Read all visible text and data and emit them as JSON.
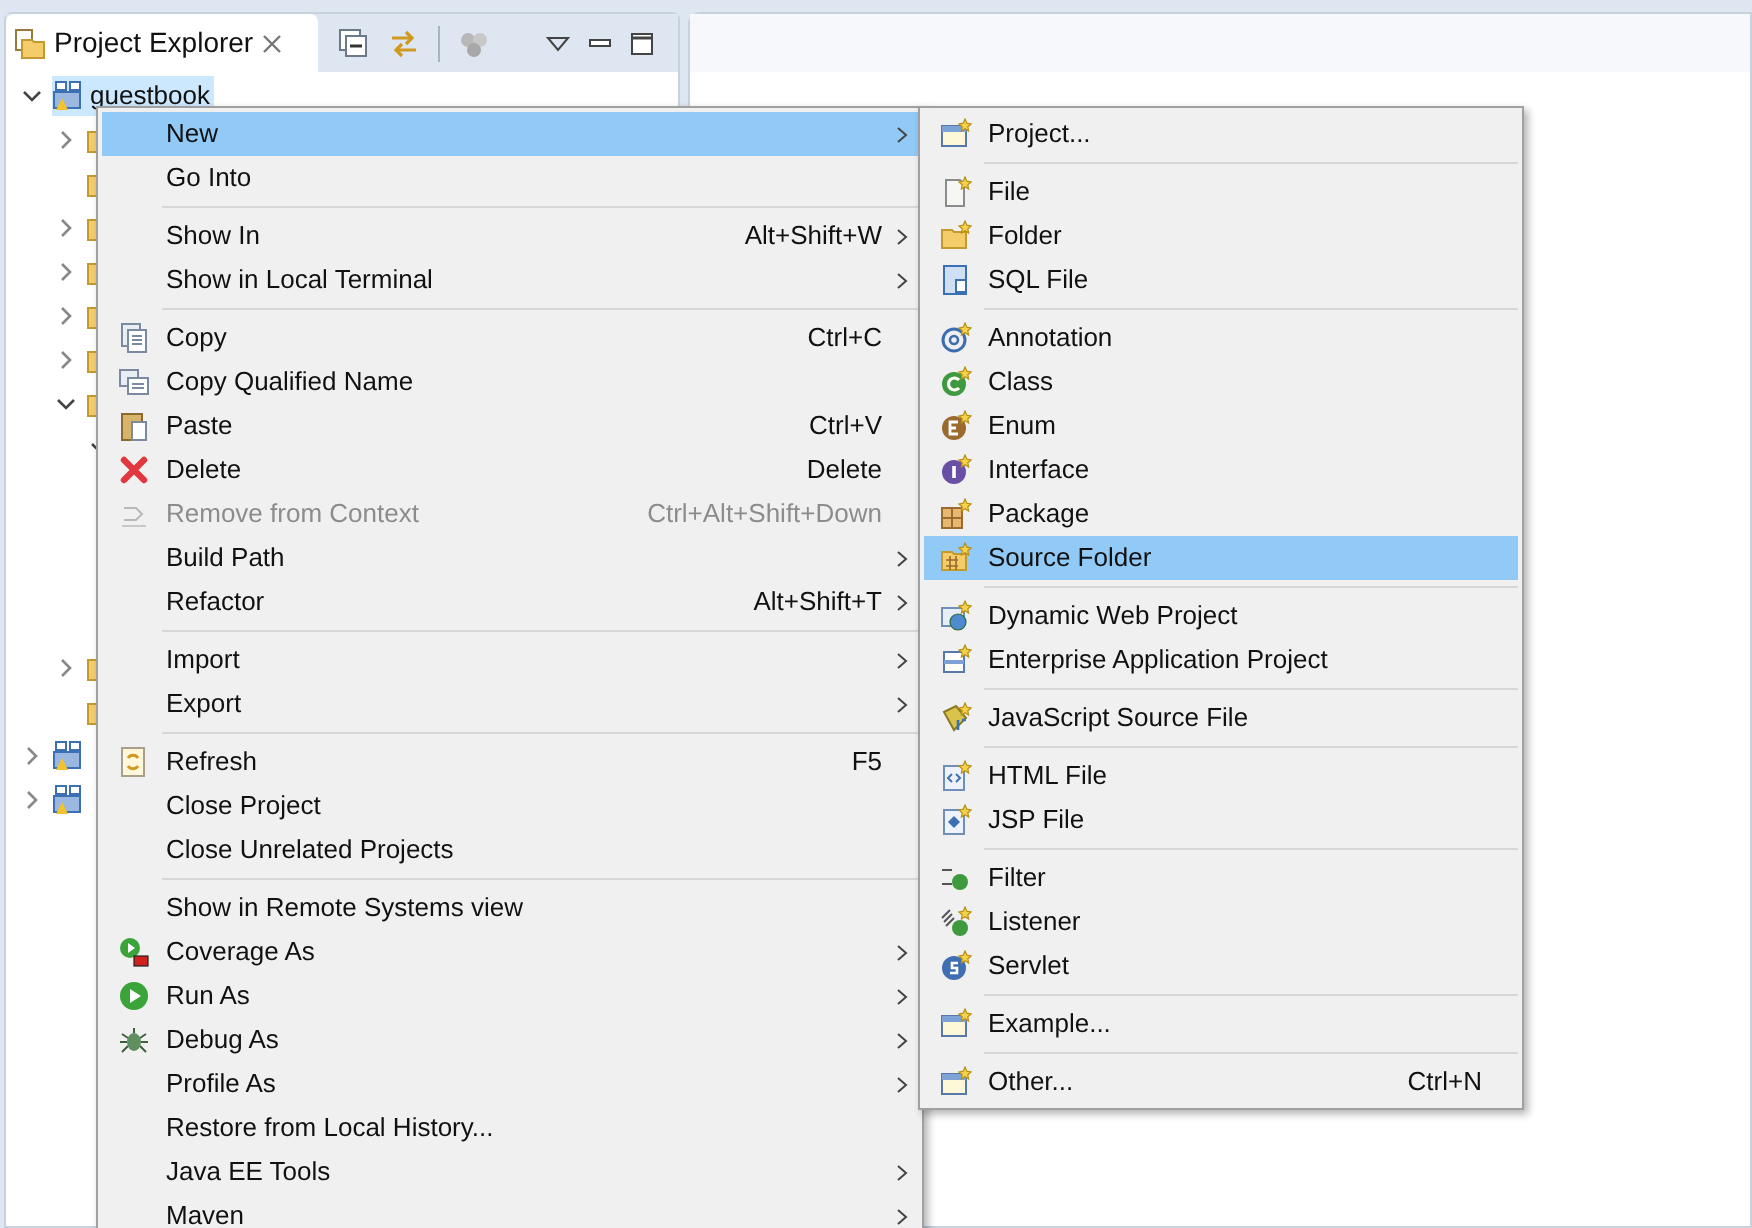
{
  "panel": {
    "title": "Project Explorer"
  },
  "tree": [
    {
      "label": "guestbook",
      "kind": "node",
      "expanded": true,
      "selected": true,
      "children": [
        {
          "kind": "node",
          "expanded": false
        },
        {
          "kind": "leaf"
        },
        {
          "kind": "node",
          "expanded": false
        },
        {
          "kind": "node",
          "expanded": false
        },
        {
          "kind": "node",
          "expanded": false
        },
        {
          "kind": "node",
          "expanded": false
        },
        {
          "kind": "node",
          "expanded": true,
          "children": [
            {
              "kind": "node",
              "expanded": true
            }
          ]
        },
        {
          "kind": "node",
          "expanded": false
        },
        {
          "kind": "leaf"
        }
      ]
    },
    {
      "kind": "node",
      "expanded": false
    },
    {
      "kind": "node",
      "expanded": false
    }
  ],
  "context_menu": [
    {
      "kind": "item",
      "label": "New",
      "selected": true,
      "disabled": false,
      "submenu": true
    },
    {
      "kind": "item",
      "label": "Go Into",
      "selected": false,
      "disabled": false,
      "submenu": false
    },
    {
      "kind": "separator"
    },
    {
      "kind": "item",
      "label": "Show In",
      "shortcut": "Alt+Shift+W",
      "selected": false,
      "disabled": false,
      "submenu": true
    },
    {
      "kind": "item",
      "label": "Show in Local Terminal",
      "selected": false,
      "disabled": false,
      "submenu": true
    },
    {
      "kind": "separator"
    },
    {
      "kind": "item",
      "label": "Copy",
      "shortcut": "Ctrl+C",
      "selected": false,
      "disabled": false,
      "submenu": false
    },
    {
      "kind": "item",
      "label": "Copy Qualified Name",
      "selected": false,
      "disabled": false,
      "submenu": false
    },
    {
      "kind": "item",
      "label": "Paste",
      "shortcut": "Ctrl+V",
      "selected": false,
      "disabled": false,
      "submenu": false
    },
    {
      "kind": "item",
      "label": "Delete",
      "shortcut": "Delete",
      "selected": false,
      "disabled": false,
      "submenu": false
    },
    {
      "kind": "item",
      "label": "Remove from Context",
      "shortcut": "Ctrl+Alt+Shift+Down",
      "selected": false,
      "disabled": true,
      "submenu": false
    },
    {
      "kind": "item",
      "label": "Build Path",
      "selected": false,
      "disabled": false,
      "submenu": true
    },
    {
      "kind": "item",
      "label": "Refactor",
      "shortcut": "Alt+Shift+T",
      "selected": false,
      "disabled": false,
      "submenu": true
    },
    {
      "kind": "separator"
    },
    {
      "kind": "item",
      "label": "Import",
      "selected": false,
      "disabled": false,
      "submenu": true
    },
    {
      "kind": "item",
      "label": "Export",
      "selected": false,
      "disabled": false,
      "submenu": true
    },
    {
      "kind": "separator"
    },
    {
      "kind": "item",
      "label": "Refresh",
      "shortcut": "F5",
      "selected": false,
      "disabled": false,
      "submenu": false
    },
    {
      "kind": "item",
      "label": "Close Project",
      "selected": false,
      "disabled": false,
      "submenu": false
    },
    {
      "kind": "item",
      "label": "Close Unrelated Projects",
      "selected": false,
      "disabled": false,
      "submenu": false
    },
    {
      "kind": "separator"
    },
    {
      "kind": "item",
      "label": "Show in Remote Systems view",
      "selected": false,
      "disabled": false,
      "submenu": false
    },
    {
      "kind": "item",
      "label": "Coverage As",
      "selected": false,
      "disabled": false,
      "submenu": true
    },
    {
      "kind": "item",
      "label": "Run As",
      "selected": false,
      "disabled": false,
      "submenu": true
    },
    {
      "kind": "item",
      "label": "Debug As",
      "selected": false,
      "disabled": false,
      "submenu": true
    },
    {
      "kind": "item",
      "label": "Profile As",
      "selected": false,
      "disabled": false,
      "submenu": true
    },
    {
      "kind": "item",
      "label": "Restore from Local History...",
      "selected": false,
      "disabled": false,
      "submenu": false
    },
    {
      "kind": "item",
      "label": "Java EE Tools",
      "selected": false,
      "disabled": false,
      "submenu": true
    },
    {
      "kind": "item",
      "label": "Maven",
      "selected": false,
      "disabled": false,
      "submenu": true
    }
  ],
  "new_submenu": [
    {
      "kind": "item",
      "label": "Project...",
      "selected": false
    },
    {
      "kind": "separator"
    },
    {
      "kind": "item",
      "label": "File",
      "selected": false
    },
    {
      "kind": "item",
      "label": "Folder",
      "selected": false
    },
    {
      "kind": "item",
      "label": "SQL File",
      "selected": false
    },
    {
      "kind": "separator"
    },
    {
      "kind": "item",
      "label": "Annotation",
      "selected": false
    },
    {
      "kind": "item",
      "label": "Class",
      "selected": false
    },
    {
      "kind": "item",
      "label": "Enum",
      "selected": false
    },
    {
      "kind": "item",
      "label": "Interface",
      "selected": false
    },
    {
      "kind": "item",
      "label": "Package",
      "selected": false
    },
    {
      "kind": "item",
      "label": "Source Folder",
      "selected": true
    },
    {
      "kind": "separator"
    },
    {
      "kind": "item",
      "label": "Dynamic Web Project",
      "selected": false
    },
    {
      "kind": "item",
      "label": "Enterprise Application Project",
      "selected": false
    },
    {
      "kind": "separator"
    },
    {
      "kind": "item",
      "label": "JavaScript Source File",
      "selected": false
    },
    {
      "kind": "separator"
    },
    {
      "kind": "item",
      "label": "HTML File",
      "selected": false
    },
    {
      "kind": "item",
      "label": "JSP File",
      "selected": false
    },
    {
      "kind": "separator"
    },
    {
      "kind": "item",
      "label": "Filter",
      "selected": false
    },
    {
      "kind": "item",
      "label": "Listener",
      "selected": false
    },
    {
      "kind": "item",
      "label": "Servlet",
      "selected": false
    },
    {
      "kind": "separator"
    },
    {
      "kind": "item",
      "label": "Example...",
      "selected": false
    },
    {
      "kind": "separator"
    },
    {
      "kind": "item",
      "label": "Other...",
      "shortcut": "Ctrl+N",
      "selected": false
    }
  ]
}
